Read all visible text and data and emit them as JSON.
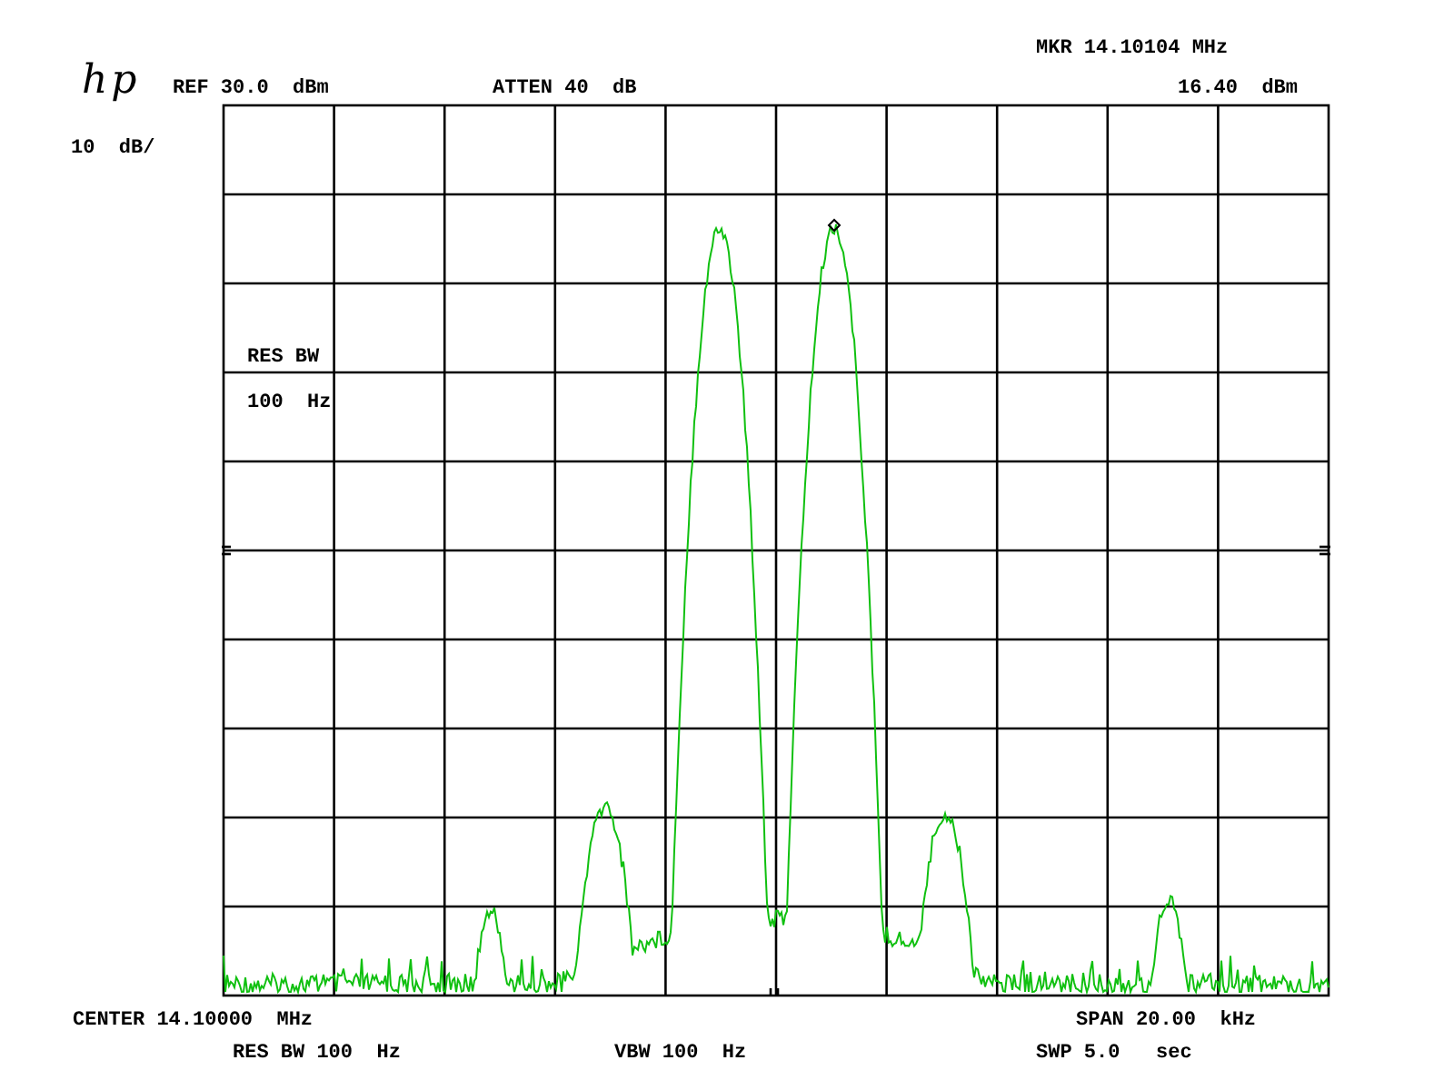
{
  "header": {
    "marker_frequency": "MKR 14.10104 MHz",
    "logo": "hp",
    "reference_level": "REF 30.0  dBm",
    "attenuation": "ATTEN 40  dB",
    "marker_amplitude": "16.40  dBm"
  },
  "scale": "10  dB/",
  "annotation": {
    "label": "RES BW",
    "value": "100  Hz"
  },
  "footer": {
    "center": "CENTER 14.10000  MHz",
    "span": "SPAN 20.00  kHz",
    "resolution_bandwidth": "RES BW 100  Hz",
    "video_bandwidth": "VBW 100  Hz",
    "sweep_time": "SWP 5.0   sec"
  }
}
